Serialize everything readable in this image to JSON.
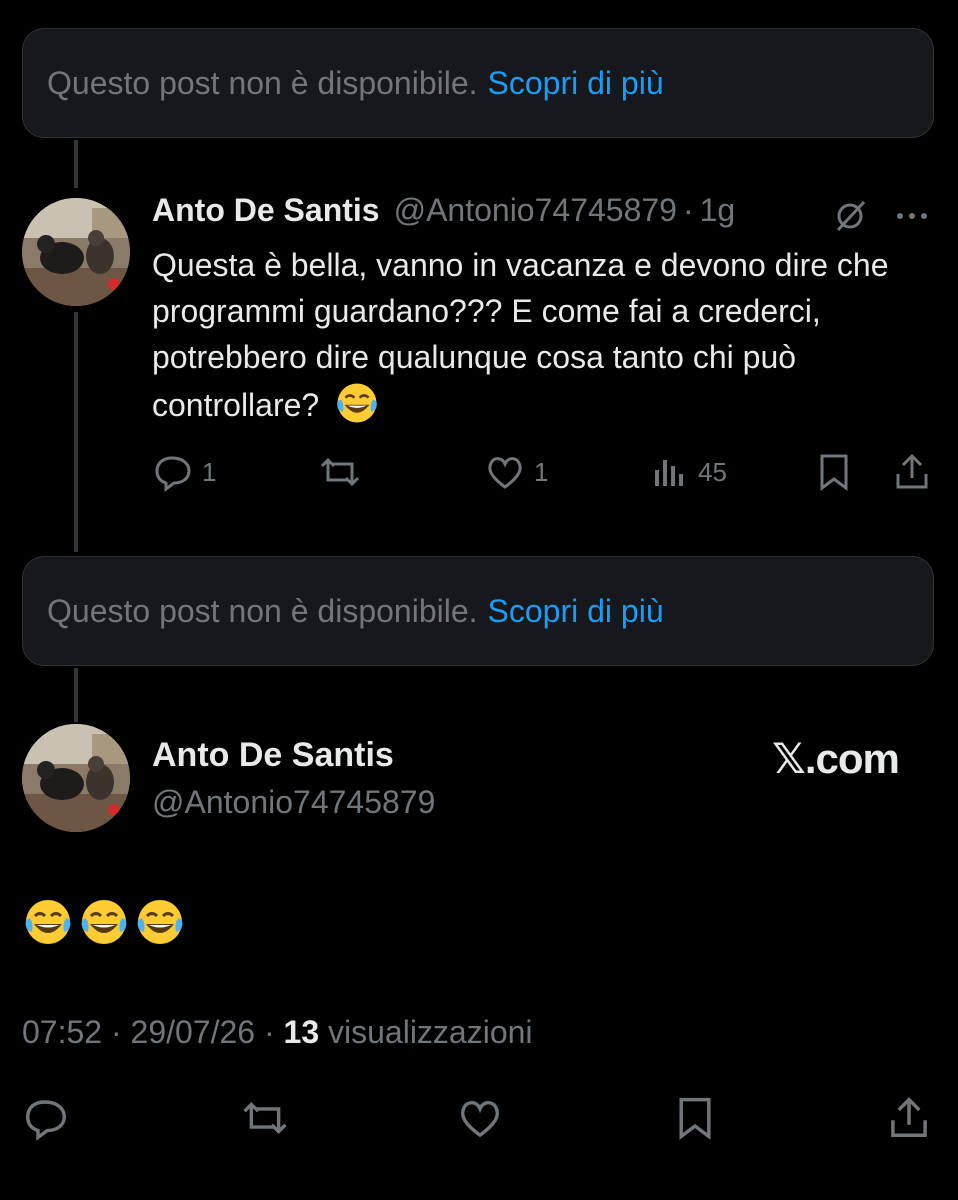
{
  "unavailable_banners": [
    {
      "text": "Questo post non è disponibile.",
      "link": "Scopri di più"
    },
    {
      "text": "Questo post non è disponibile.",
      "link": "Scopri di più"
    }
  ],
  "reply": {
    "name": "Anto De Santis",
    "handle": "@Antonio74745879",
    "separator": "·",
    "time": "1g",
    "body": "Questa è bella, vanno in vacanza e devono dire che programmi guardano??? E come fai a crederci, potrebbero dire qualunque cosa tanto chi può controllare?",
    "reply_count": "1",
    "like_count": "1",
    "view_count": "45"
  },
  "main_post": {
    "name": "Anto De Santis",
    "handle": "@Antonio74745879",
    "site_label": "𝕏.com",
    "time": "07:52",
    "sep": "·",
    "date": "29/07/26",
    "views_count": "13",
    "views_label": "visualizzazioni"
  },
  "colors": {
    "background": "#000000",
    "text": "#e7e9ea",
    "muted": "#71767b",
    "link": "#1d9bf0",
    "card": "#16181c"
  },
  "icons": [
    "grok-icon",
    "more-icon",
    "reply-icon",
    "repost-icon",
    "like-icon",
    "views-icon",
    "bookmark-icon",
    "share-icon",
    "laughing-emoji"
  ]
}
